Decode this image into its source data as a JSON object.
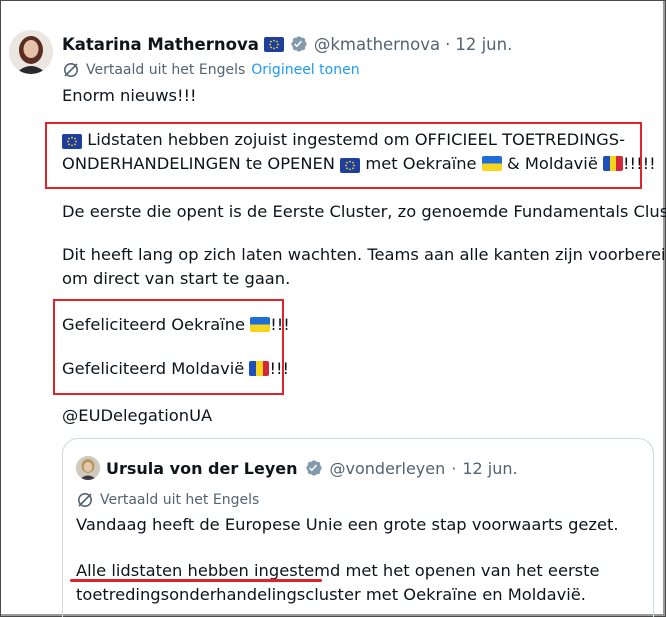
{
  "tweet": {
    "author_name": "Katarina Mathernova",
    "author_handle": "@kmathernova",
    "separator": "·",
    "date": "12 jun.",
    "translated_label": "Vertaald uit het Engels",
    "show_original_label": "Origineel tonen",
    "line_1": "Enorm nieuws!!!",
    "line_2a": "Lidstaten hebben zojuist ingestemd om OFFICIEEL TOETREDINGS-",
    "line_2b_start": "ONDERHANDELINGEN te OPENEN",
    "line_2b_mid": "met Oekraïne",
    "line_2b_amp": "& Moldavië",
    "line_2b_end": "!!!!!",
    "line_3": "De eerste die opent is de Eerste Cluster, zo genoemde Fundamentals Cluster.",
    "line_4a": "Dit heeft lang op zich laten wachten. Teams aan alle kanten zijn voorbereid",
    "line_4b": "om direct van start te gaan.",
    "line_5": "Gefeliciteerd Oekraïne",
    "line_5_end": "!!!",
    "line_6": "Gefeliciteerd Moldavië",
    "line_6_end": "!!!",
    "mention": "@EUDelegationUA"
  },
  "quoted_tweet": {
    "author_name": "Ursula von der Leyen",
    "author_handle": "@vonderleyen",
    "separator": "·",
    "date": "12 jun.",
    "translated_label": "Vertaald uit het Engels",
    "line_1": "Vandaag heeft de Europese Unie een grote stap voorwaarts gezet.",
    "line_2": "Alle lidstaten hebben ingestemd met het openen van het eerste",
    "line_3": "toetredingsonderhandelingscluster met Oekraïne en Moldavië."
  },
  "colors": {
    "link": "#1d9bf0",
    "verified": "#829aab",
    "highlight_box": "#e0232a",
    "eu_blue": "#1f3f9c"
  },
  "icons": [
    "eu-flag-icon",
    "verified-badge-icon",
    "translate-icon",
    "ukraine-flag-icon",
    "moldova-flag-icon"
  ]
}
